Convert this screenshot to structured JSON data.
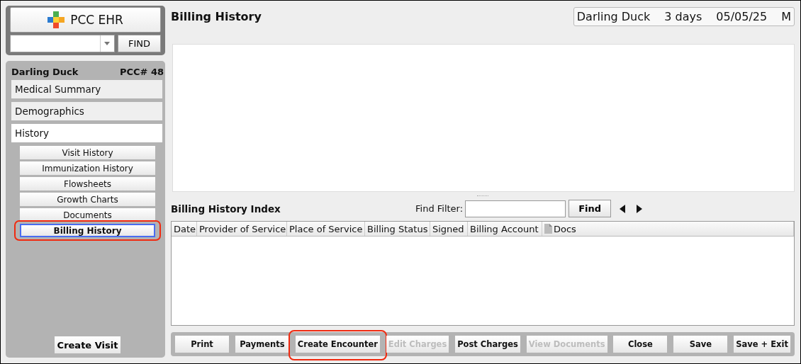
{
  "app": {
    "logo_text": "PCC EHR",
    "find_button": "FIND"
  },
  "patient": {
    "name": "Darling Duck",
    "chart": "PCC# 48"
  },
  "nav": [
    {
      "label": "Medical Summary",
      "selected": false
    },
    {
      "label": "Demographics",
      "selected": false
    },
    {
      "label": "History",
      "selected": true,
      "children": [
        {
          "label": "Visit History",
          "selected": false,
          "highlighted": false
        },
        {
          "label": "Immunization History",
          "selected": false,
          "highlighted": false
        },
        {
          "label": "Flowsheets",
          "selected": false,
          "highlighted": false
        },
        {
          "label": "Growth Charts",
          "selected": false,
          "highlighted": false
        },
        {
          "label": "Documents",
          "selected": false,
          "highlighted": false
        },
        {
          "label": "Billing History",
          "selected": true,
          "highlighted": true
        }
      ]
    }
  ],
  "create_visit_button": "Create Visit",
  "page_title": "Billing History",
  "patient_banner": [
    "Darling Duck",
    "3 days",
    "05/05/25",
    "M"
  ],
  "index": {
    "title": "Billing History Index",
    "filter_label": "Find Filter:",
    "find_button": "Find"
  },
  "table": {
    "columns": [
      {
        "label": "Date",
        "kind": "text"
      },
      {
        "label": "Provider of Service",
        "kind": "text"
      },
      {
        "label": "Place of Service",
        "kind": "text"
      },
      {
        "label": "Billing Status",
        "kind": "text"
      },
      {
        "label": "Signed",
        "kind": "text"
      },
      {
        "label": "Billing Account",
        "kind": "text"
      },
      {
        "label": "Docs",
        "kind": "doc"
      }
    ]
  },
  "buttons": [
    {
      "label": "Print",
      "disabled": false,
      "highlighted": false
    },
    {
      "label": "Payments",
      "disabled": false,
      "highlighted": false
    },
    {
      "label": "Create Encounter",
      "disabled": false,
      "highlighted": true
    },
    {
      "label": "Edit Charges",
      "disabled": true,
      "highlighted": false
    },
    {
      "label": "Post Charges",
      "disabled": false,
      "highlighted": false
    },
    {
      "label": "View Documents",
      "disabled": true,
      "highlighted": false
    },
    {
      "label": "Close",
      "disabled": false,
      "highlighted": false
    },
    {
      "label": "Save",
      "disabled": false,
      "highlighted": false
    },
    {
      "label": "Save + Exit",
      "disabled": false,
      "highlighted": false
    }
  ]
}
